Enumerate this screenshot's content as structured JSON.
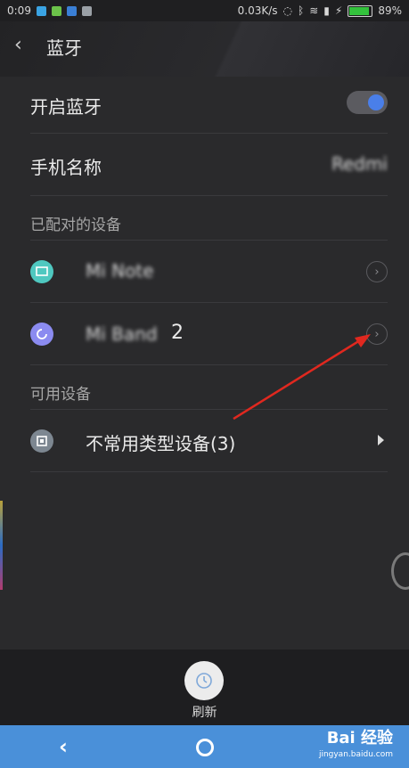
{
  "status_bar": {
    "time": "0:09",
    "speed": "0.03K/s",
    "battery": "89%",
    "battery_level": 0.89
  },
  "header": {
    "title": "蓝牙"
  },
  "settings": {
    "bluetooth_toggle_label": "开启蓝牙",
    "bluetooth_enabled": true,
    "phone_name_label": "手机名称",
    "phone_name_value": "Redmi"
  },
  "paired_section": {
    "title": "已配对的设备",
    "devices": [
      {
        "name": "Mi Note",
        "icon": "laptop-icon",
        "icon_color": "#4fc8c0"
      },
      {
        "name": "Mi Band",
        "suffix": "2",
        "icon": "refresh-circle-icon",
        "icon_color": "#8b8bf0"
      }
    ]
  },
  "available_section": {
    "title": "可用设备",
    "item_label": "不常用类型设备(3)",
    "icon_color": "#7d8791"
  },
  "bottom": {
    "refresh_label": "刷新"
  },
  "watermark": {
    "brand": "Bai 经验",
    "domain": "jingyan.baidu.com"
  }
}
